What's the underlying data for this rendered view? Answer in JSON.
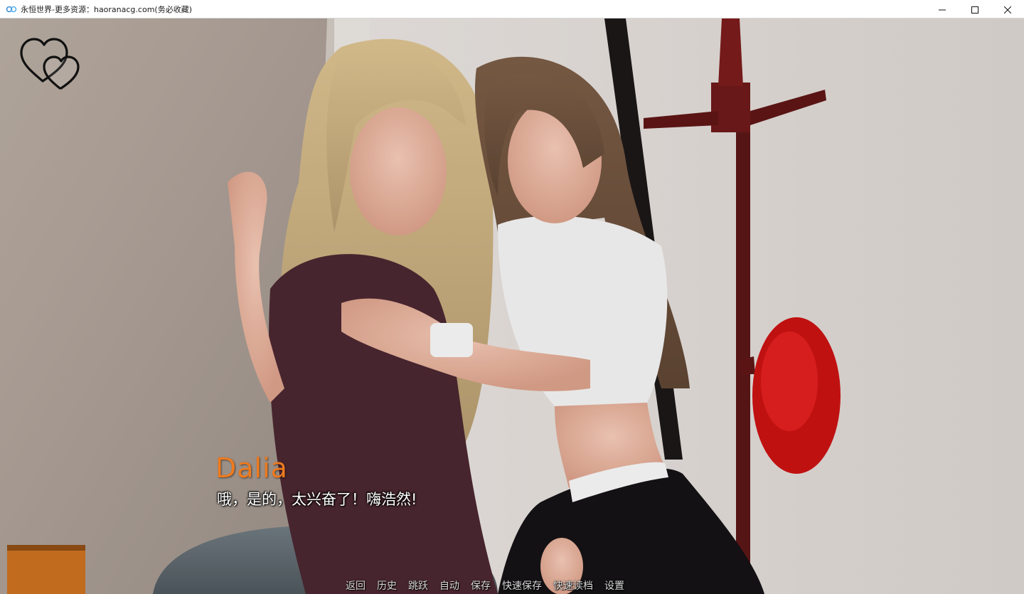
{
  "window": {
    "title": "永恒世界-更多资源：haoranacg.com(务必收藏)",
    "controls": {
      "minimize_icon": "minimize-icon",
      "maximize_icon": "maximize-icon",
      "close_icon": "close-icon"
    }
  },
  "scene": {
    "description_icon": "affection-hearts-icon"
  },
  "dialogue": {
    "speaker": "Dalia",
    "speaker_color": "#ee7a1e",
    "text": "哦，是的，太兴奋了！嗨浩然!"
  },
  "quick_menu": {
    "items": [
      {
        "label": "返回"
      },
      {
        "label": "历史"
      },
      {
        "label": "跳跃"
      },
      {
        "label": "自动"
      },
      {
        "label": "保存"
      },
      {
        "label": "快速保存"
      },
      {
        "label": "快速读档"
      },
      {
        "label": "设置"
      }
    ]
  }
}
